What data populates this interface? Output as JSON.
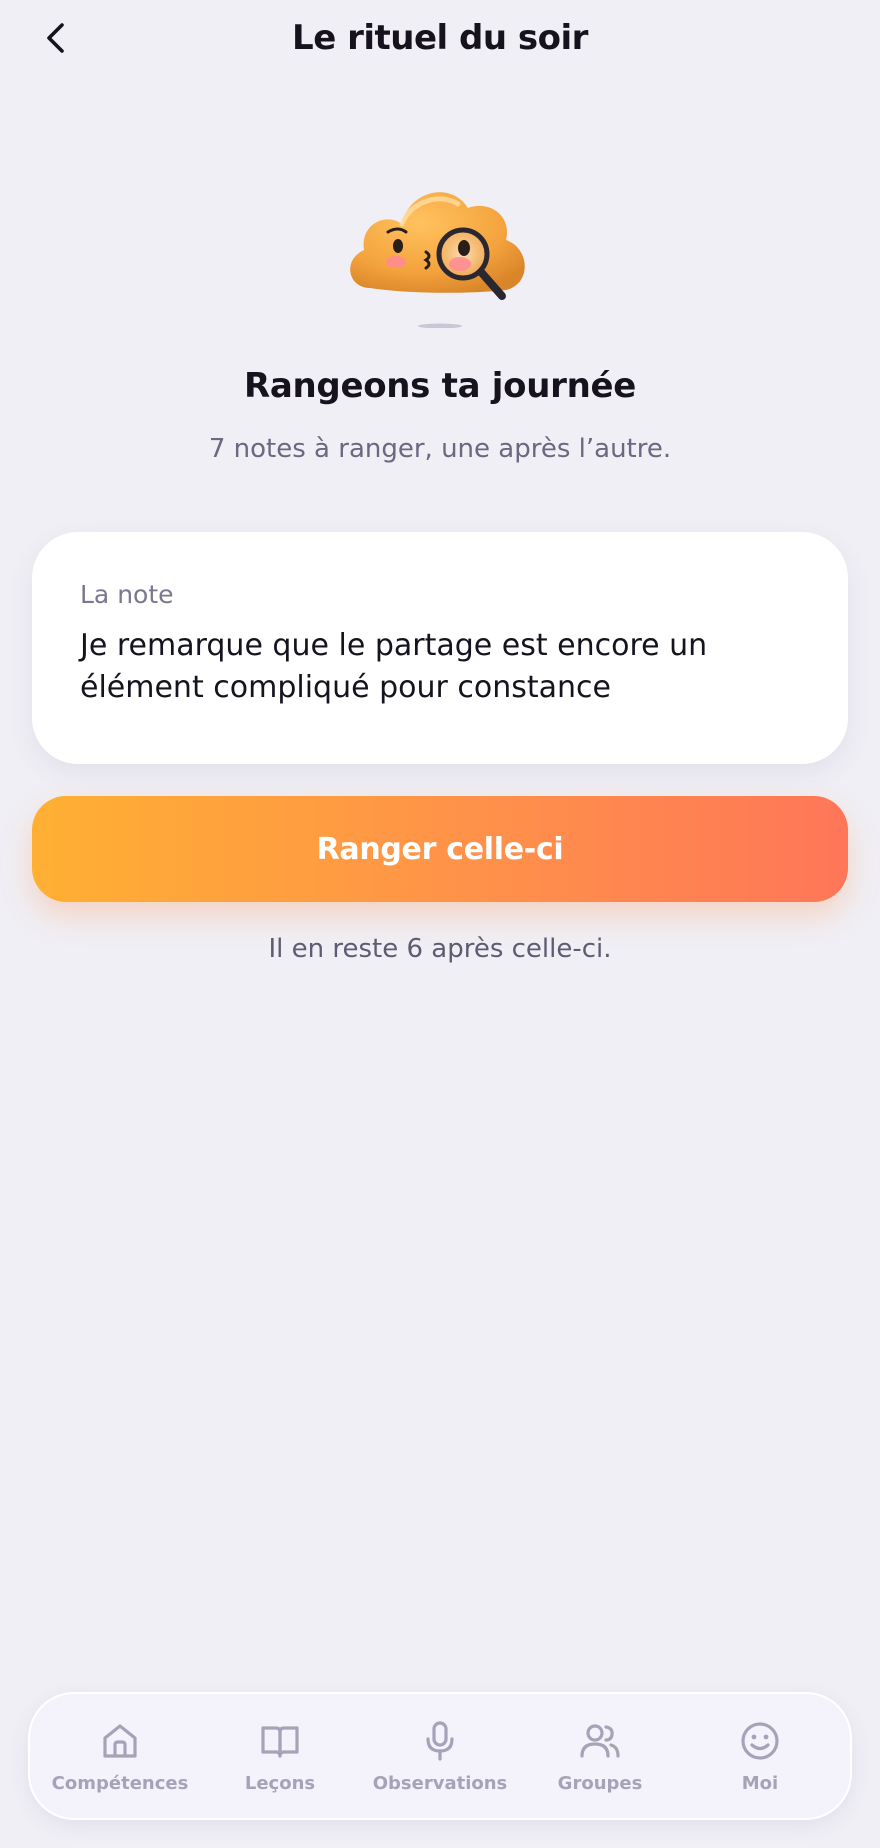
{
  "header": {
    "title": "Le rituel du soir",
    "back_icon": "chevron-left-icon"
  },
  "mascot": {
    "icon": "cloud-magnifier-mascot"
  },
  "intro": {
    "title": "Rangeons ta journée",
    "subtitle": "7 notes à ranger, une après l’autre."
  },
  "note_card": {
    "label": "La note",
    "text": "Je remarque que le partage est encore un élément compliqué pour constance"
  },
  "primary_button": {
    "label": "Ranger celle-ci"
  },
  "remaining_text": "Il en reste 6 après celle-ci.",
  "tabbar": {
    "items": [
      {
        "label": "Compétences",
        "icon": "home-icon"
      },
      {
        "label": "Leçons",
        "icon": "book-icon"
      },
      {
        "label": "Observations",
        "icon": "microphone-icon"
      },
      {
        "label": "Groupes",
        "icon": "users-icon"
      },
      {
        "label": "Moi",
        "icon": "smile-icon"
      }
    ]
  },
  "colors": {
    "background": "#f0eff5",
    "accent_start": "#ffb033",
    "accent_end": "#ff7658",
    "tab_inactive": "#a6a3b8"
  }
}
